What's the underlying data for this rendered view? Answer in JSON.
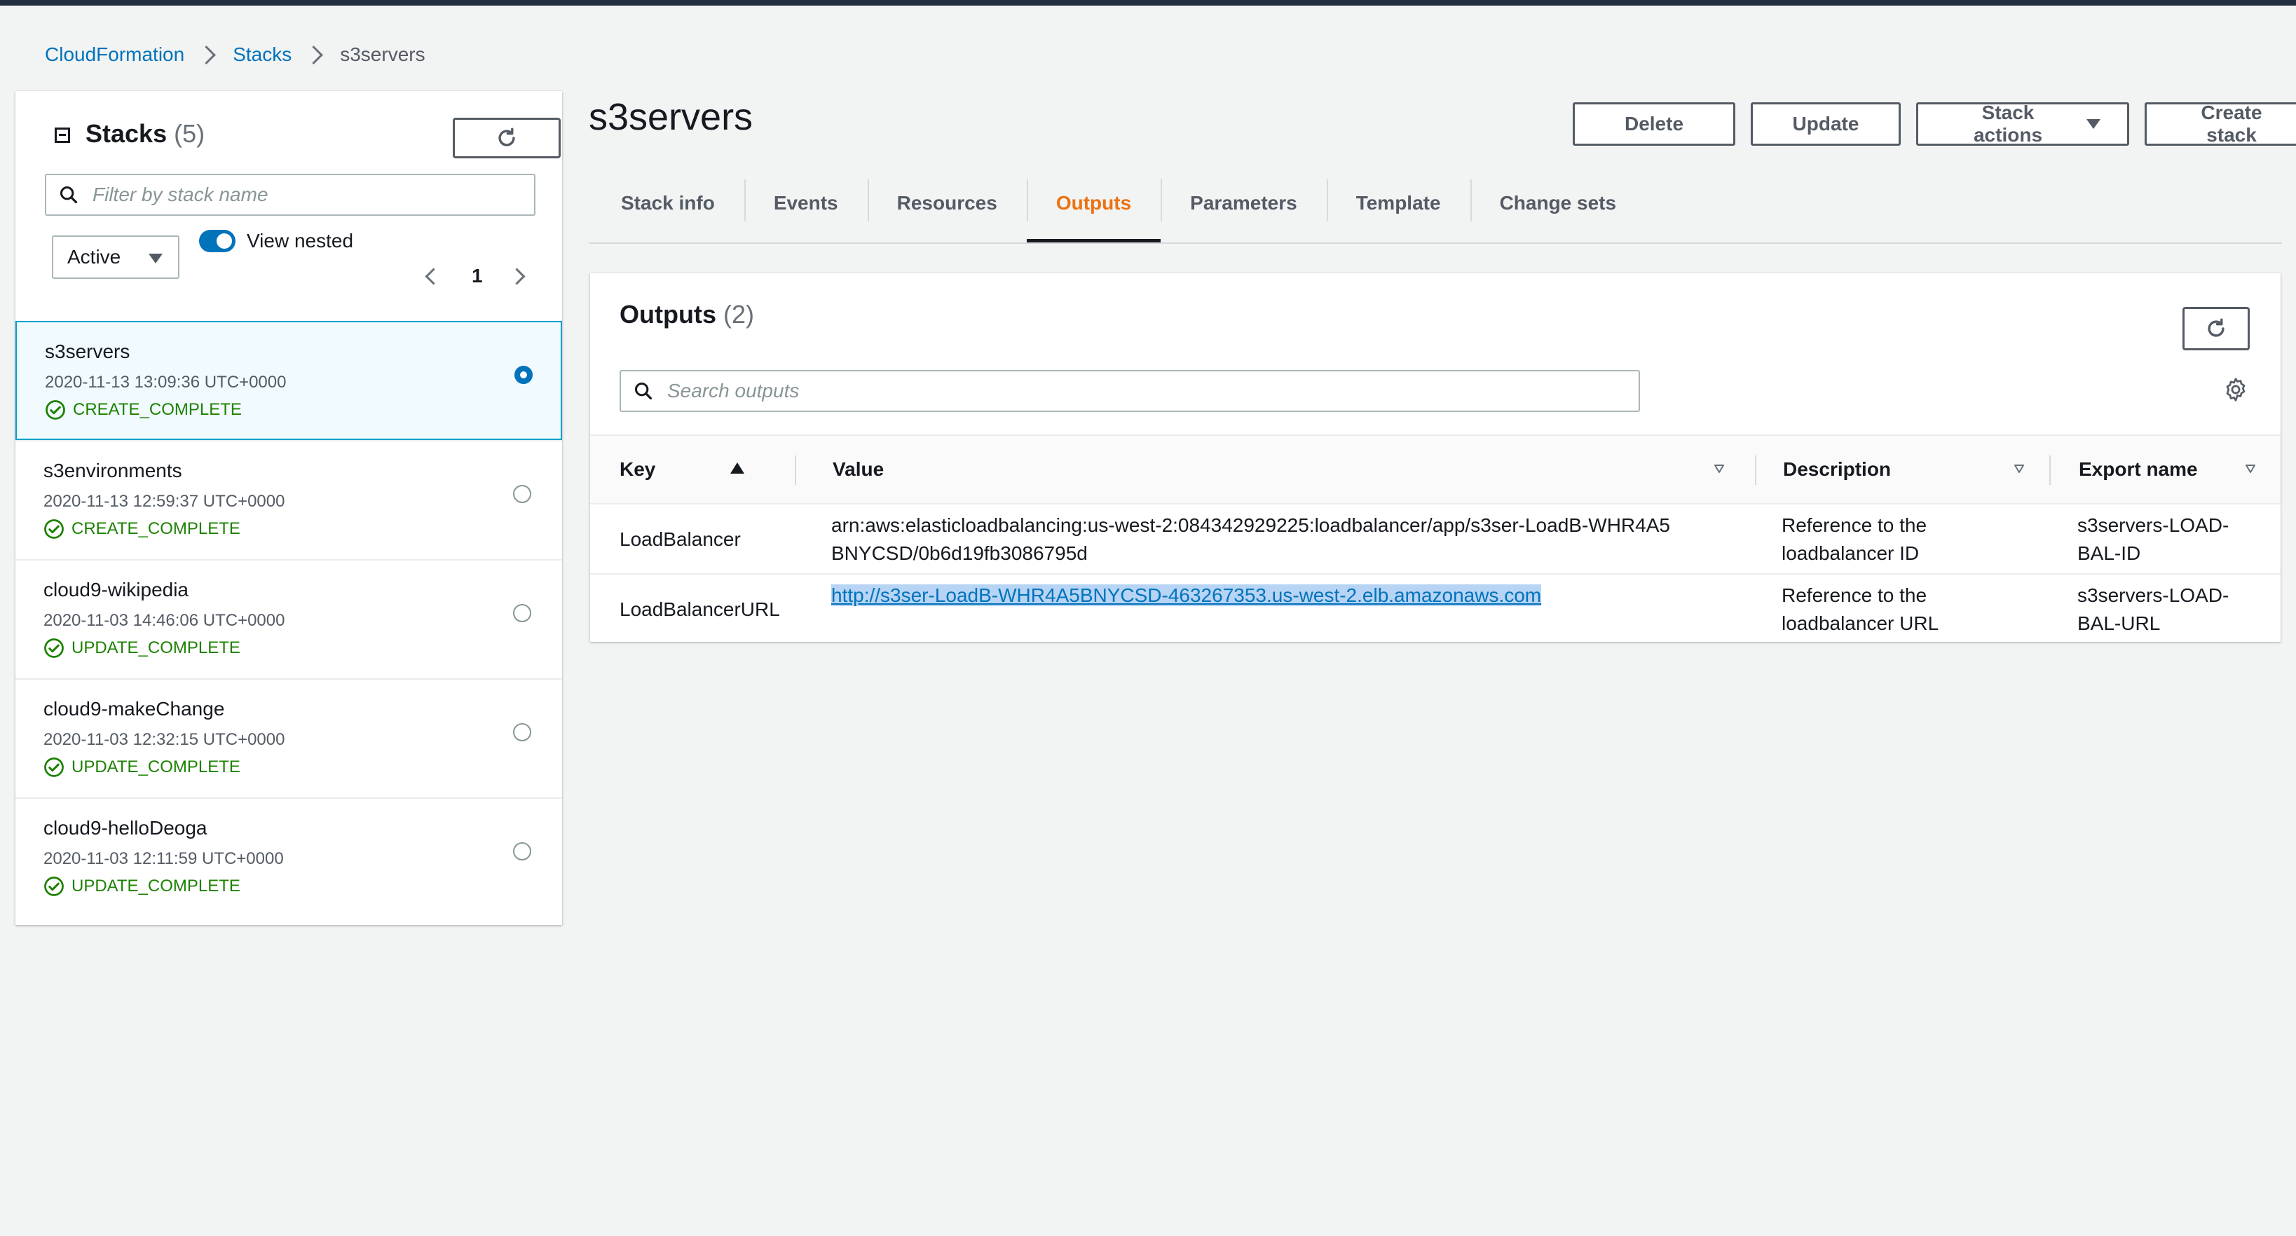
{
  "breadcrumb": {
    "root": "CloudFormation",
    "stacks": "Stacks",
    "current": "s3servers"
  },
  "left_panel": {
    "title": "Stacks",
    "count": "(5)",
    "filter_placeholder": "Filter by stack name",
    "filter_select": "Active",
    "toggle_label": "View nested",
    "toggle_on": true,
    "page": "1",
    "stacks": [
      {
        "name": "s3servers",
        "time": "2020-11-13 13:09:36 UTC+0000",
        "status": "CREATE_COMPLETE",
        "selected": true
      },
      {
        "name": "s3environments",
        "time": "2020-11-13 12:59:37 UTC+0000",
        "status": "CREATE_COMPLETE",
        "selected": false
      },
      {
        "name": "cloud9-wikipedia",
        "time": "2020-11-03 14:46:06 UTC+0000",
        "status": "UPDATE_COMPLETE",
        "selected": false
      },
      {
        "name": "cloud9-makeChange",
        "time": "2020-11-03 12:32:15 UTC+0000",
        "status": "UPDATE_COMPLETE",
        "selected": false
      },
      {
        "name": "cloud9-helloDeoga",
        "time": "2020-11-03 12:11:59 UTC+0000",
        "status": "UPDATE_COMPLETE",
        "selected": false
      }
    ]
  },
  "main": {
    "title": "s3servers",
    "buttons": {
      "delete": "Delete",
      "update": "Update",
      "stack_actions": "Stack actions",
      "create_stack": "Create stack"
    },
    "tabs": [
      {
        "label": "Stack info",
        "active": false
      },
      {
        "label": "Events",
        "active": false
      },
      {
        "label": "Resources",
        "active": false
      },
      {
        "label": "Outputs",
        "active": true
      },
      {
        "label": "Parameters",
        "active": false
      },
      {
        "label": "Template",
        "active": false
      },
      {
        "label": "Change sets",
        "active": false
      }
    ]
  },
  "outputs": {
    "title": "Outputs",
    "count": "(2)",
    "search_placeholder": "Search outputs",
    "columns": {
      "key": "Key",
      "value": "Value",
      "description": "Description",
      "export": "Export name"
    },
    "rows": [
      {
        "key": "LoadBalancer",
        "value": "arn:aws:elasticloadbalancing:us-west-2:084342929225:loadbalancer/app/s3ser-LoadB-WHR4A5BNYCSD/0b6d19fb3086795d",
        "description": "Reference to the loadbalancer ID",
        "export": "s3servers-LOAD-BAL-ID"
      },
      {
        "key": "LoadBalancerURL",
        "value": "http://s3ser-LoadB-WHR4A5BNYCSD-463267353.us-west-2.elb.amazonaws.com",
        "description": "Reference to the loadbalancer URL",
        "export": "s3servers-LOAD-BAL-URL"
      }
    ]
  },
  "colors": {
    "accent": "#0073bb",
    "active_tab": "#ec7211",
    "success": "#1d8102",
    "topbar": "#232f3e"
  }
}
